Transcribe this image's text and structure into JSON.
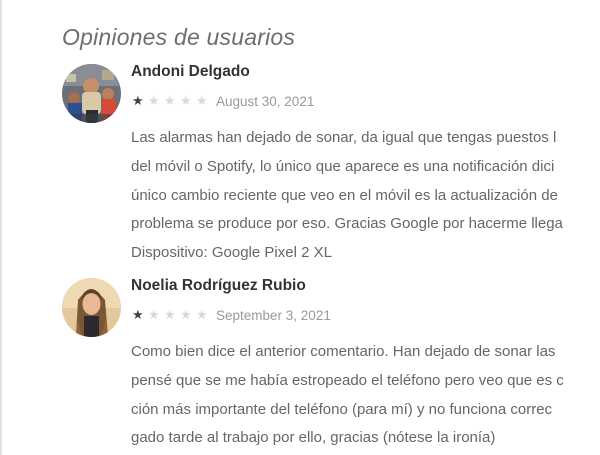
{
  "section": {
    "title": "Opiniones de usuarios"
  },
  "reviews": [
    {
      "author": "Andoni Delgado",
      "rating": 1,
      "max_rating": 5,
      "date": "August 30, 2021",
      "lines": [
        "Las alarmas han dejado de sonar, da igual que tengas puestos l",
        "del móvil o Spotify, lo único que aparece es una notificación dici",
        "único cambio reciente que veo en el móvil es la actualización de",
        "problema se produce por eso. Gracias Google por hacerme llega",
        "Dispositivo: Google Pixel 2 XL"
      ]
    },
    {
      "author": "Noelia Rodríguez Rubio",
      "rating": 1,
      "max_rating": 5,
      "date": "September 3, 2021",
      "lines": [
        "Como bien dice el anterior comentario. Han dejado de sonar las",
        "pensé que se me había estropeado el teléfono pero veo que es c",
        "ción más importante del teléfono (para mí) y no funciona correc",
        "gado tarde al trabajo por ello, gracias (nótese la ironía)"
      ]
    }
  ],
  "colors": {
    "star_filled": "#424242",
    "star_empty": "#d9d9d9",
    "author": "#333333",
    "body": "#666666",
    "date": "#999999"
  }
}
